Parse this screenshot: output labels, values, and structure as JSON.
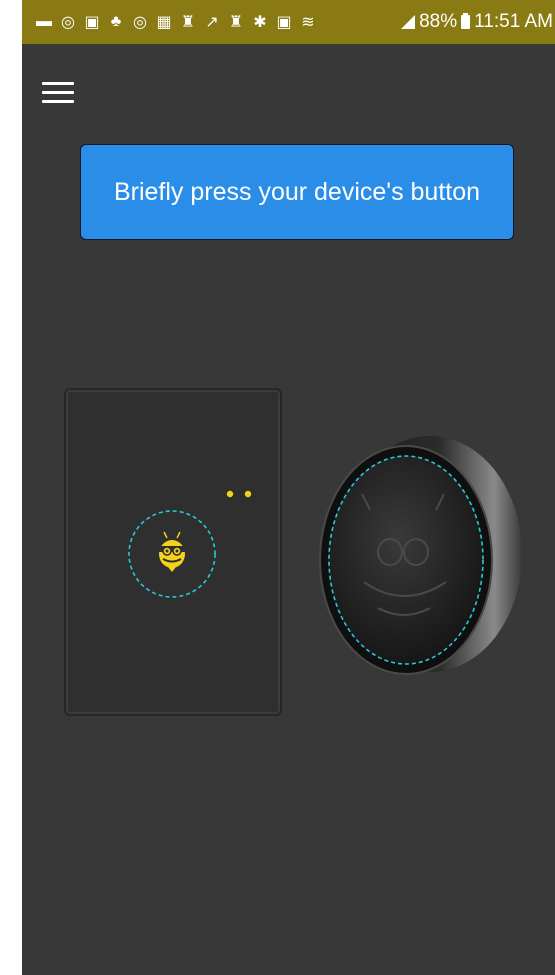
{
  "status_bar": {
    "battery_percent": "88%",
    "time": "11:51 AM",
    "icons": [
      "message-icon",
      "sync-icon",
      "image-icon",
      "alarm-icon",
      "sync-icon",
      "card-icon",
      "person-icon",
      "arrow-icon",
      "person-icon",
      "bluetooth-icon",
      "nfc-icon",
      "wifi-icon",
      "signal-icon",
      "battery-icon"
    ],
    "background": "#8a7a14"
  },
  "header": {
    "menu_icon": "hamburger-menu-icon"
  },
  "instruction": {
    "text": "Briefly press your device's button",
    "background": "#2a8ee8"
  },
  "devices": {
    "left": "pad-device-with-bee-logo",
    "right": "round-button-device",
    "highlight_color": "#28c8d8"
  },
  "colors": {
    "app_background": "#383838",
    "accent_yellow": "#f2d21a"
  }
}
